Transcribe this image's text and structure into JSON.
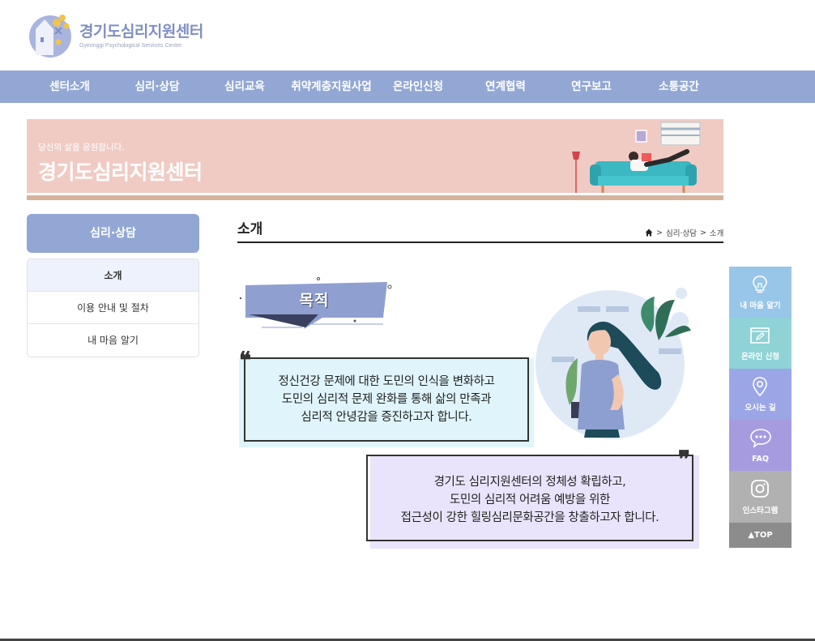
{
  "header": {
    "logo_title": "경기도심리지원센터",
    "logo_subtitle": "Gyeonggi Psychological Services Center"
  },
  "nav": {
    "items": [
      {
        "label": "센터소개"
      },
      {
        "label": "심리·상담"
      },
      {
        "label": "심리교육"
      },
      {
        "label": "취약계층지원사업"
      },
      {
        "label": "온라인신청"
      },
      {
        "label": "연계협력"
      },
      {
        "label": "연구보고"
      },
      {
        "label": "소통공간"
      }
    ]
  },
  "banner": {
    "subtitle": "당신의 삶을 응원합니다.",
    "title": "경기도심리지원센터"
  },
  "sidebar": {
    "heading": "심리·상담",
    "items": [
      {
        "label": "소개",
        "active": true
      },
      {
        "label": "이용 안내 및 절차",
        "active": false
      },
      {
        "label": "내 마음 알기",
        "active": false
      }
    ]
  },
  "content": {
    "page_title": "소개",
    "breadcrumb": {
      "level1": "심리·상담",
      "separator": ">",
      "level2": "소개"
    },
    "purpose_label": "목적",
    "quote1": [
      "정신건강 문제에 대한 도민의 인식을 변화하고",
      "도민의 심리적 문제 완화를 통해 삶의 만족과",
      "심리적 안녕감을 증진하고자 합니다."
    ],
    "quote2": [
      "경기도 심리지원센터의 정체성 확립하고,",
      "도민의 심리적 어려움 예방을 위한",
      "접근성이 강한 힐링심리문화공간을 창출하고자 합니다."
    ]
  },
  "quick_menu": {
    "items": [
      {
        "label": "내 마음 알기",
        "icon": "lightbulb-icon",
        "color": "#97c6e8"
      },
      {
        "label": "온라인 신청",
        "icon": "pencil-form-icon",
        "color": "#8fd3d6"
      },
      {
        "label": "오시는 길",
        "icon": "map-pin-icon",
        "color": "#9aa6e6"
      },
      {
        "label": "FAQ",
        "icon": "chat-bubble-icon",
        "color": "#a79be0"
      },
      {
        "label": "인스타그램",
        "icon": "instagram-icon",
        "color": "#b1b1b1"
      }
    ],
    "top_label": "▲TOP"
  },
  "colors": {
    "nav_bg": "#93a7d4",
    "banner_bg": "#f0cbc4",
    "purpose_tag": "#8f9fd0",
    "quote1_bg": "#dff5fb",
    "quote2_bg": "#e9e4fb"
  }
}
